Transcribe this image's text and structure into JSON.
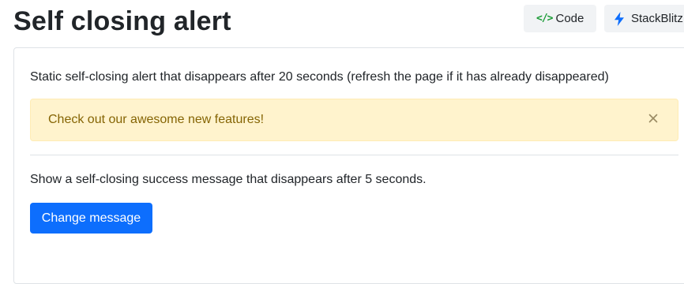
{
  "header": {
    "title": "Self closing alert",
    "code_icon": "</>",
    "code_label": "Code",
    "stackblitz_icon": "lightning-bolt",
    "stackblitz_label": "StackBlitz"
  },
  "demo": {
    "intro_text": "Static self-closing alert that disappears after 20 seconds (refresh the page if it has already disappeared)",
    "alert": {
      "message": "Check out our awesome new features!",
      "close_icon": "close-x",
      "variant_color": "#fff3cd"
    },
    "success_text": "Show a self-closing success message that disappears after 5 seconds.",
    "button_label": "Change message"
  },
  "colors": {
    "primary": "#0d6efd",
    "warning_bg": "#fff3cd",
    "warning_text": "#856404",
    "code_icon": "#1a9b36",
    "bolt": "#0d6efd"
  }
}
